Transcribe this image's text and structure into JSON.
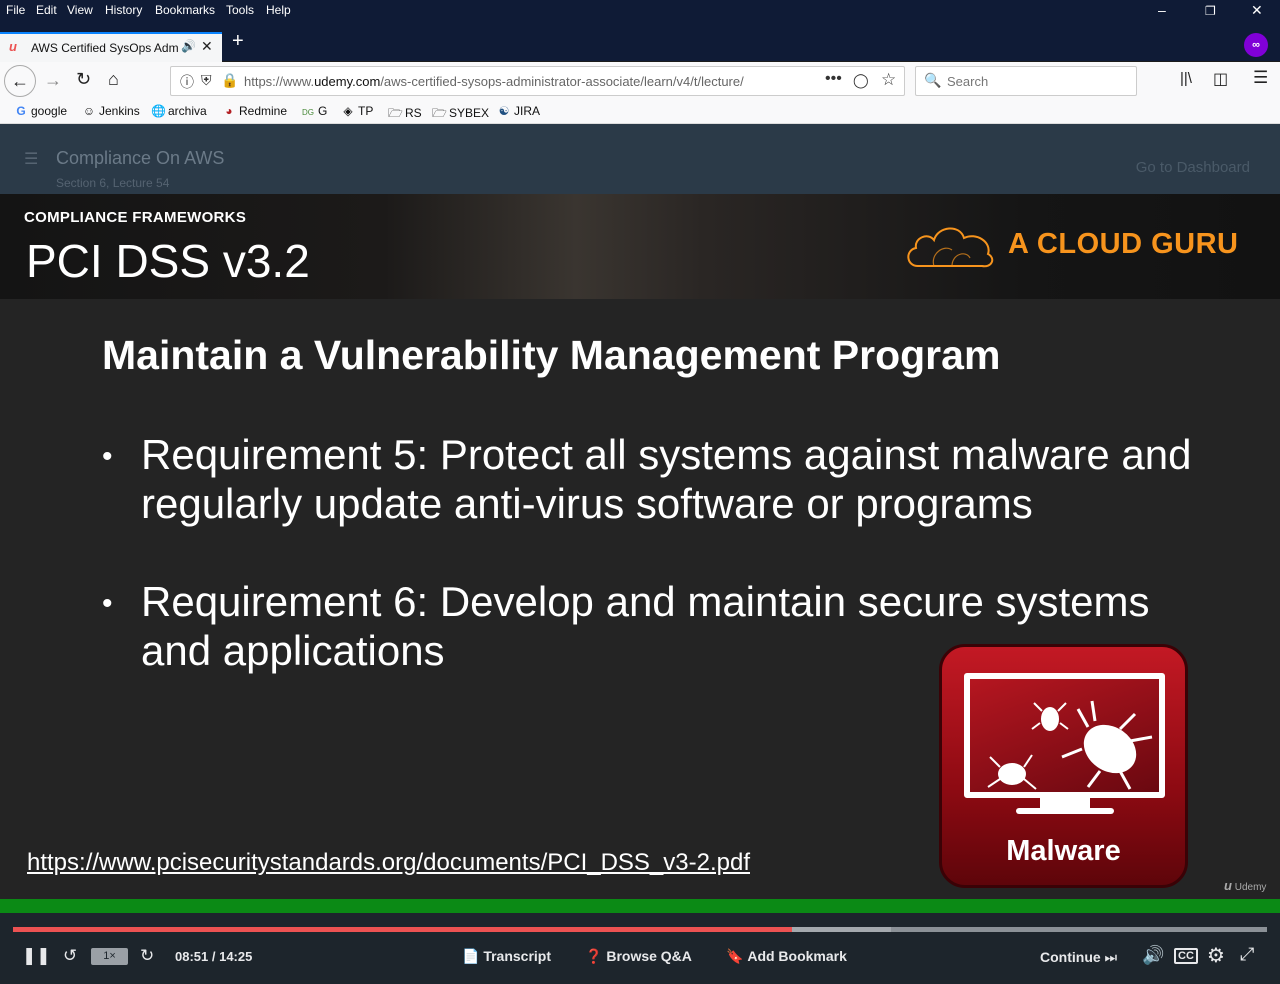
{
  "browser": {
    "menu": [
      "File",
      "Edit",
      "View",
      "History",
      "Bookmarks",
      "Tools",
      "Help"
    ],
    "tab": {
      "title": "AWS Certified SysOps Admi"
    },
    "url": {
      "prefix": "https://www.",
      "domain": "udemy.com",
      "path": "/aws-certified-sysops-administrator-associate/learn/v4/t/lecture/"
    },
    "search_placeholder": "Search",
    "bookmarks": [
      "google",
      "Jenkins",
      "archiva",
      "Redmine",
      "G",
      "TP",
      "RS",
      "SYBEX",
      "JIRA"
    ]
  },
  "course": {
    "lecture_title": "Compliance On AWS",
    "lecture_meta": "Section 6, Lecture 54",
    "dashboard_link": "Go to Dashboard"
  },
  "slide": {
    "kicker": "COMPLIANCE FRAMEWORKS",
    "title": "PCI DSS v3.2",
    "brand": "A CLOUD GURU",
    "heading": "Maintain a Vulnerability Management Program",
    "bullets": [
      {
        "line1": "Requirement 5: Protect all systems against malware and",
        "line2": "regularly update anti-virus software or programs"
      },
      {
        "line1": "Requirement 6: Develop and maintain secure systems",
        "line2": "and applications"
      }
    ],
    "link": "https://www.pcisecuritystandards.org/documents/PCI_DSS_v3-2.pdf",
    "malware_label": "Malware",
    "watermark": "Udemy"
  },
  "player": {
    "speed": "1×",
    "time": "08:51 / 14:25",
    "progress_fraction": 0.621,
    "buffered_fraction": 0.7,
    "transcript": "Transcript",
    "browse_qa": "Browse Q&A",
    "add_bookmark": "Add Bookmark",
    "continue": "Continue"
  }
}
